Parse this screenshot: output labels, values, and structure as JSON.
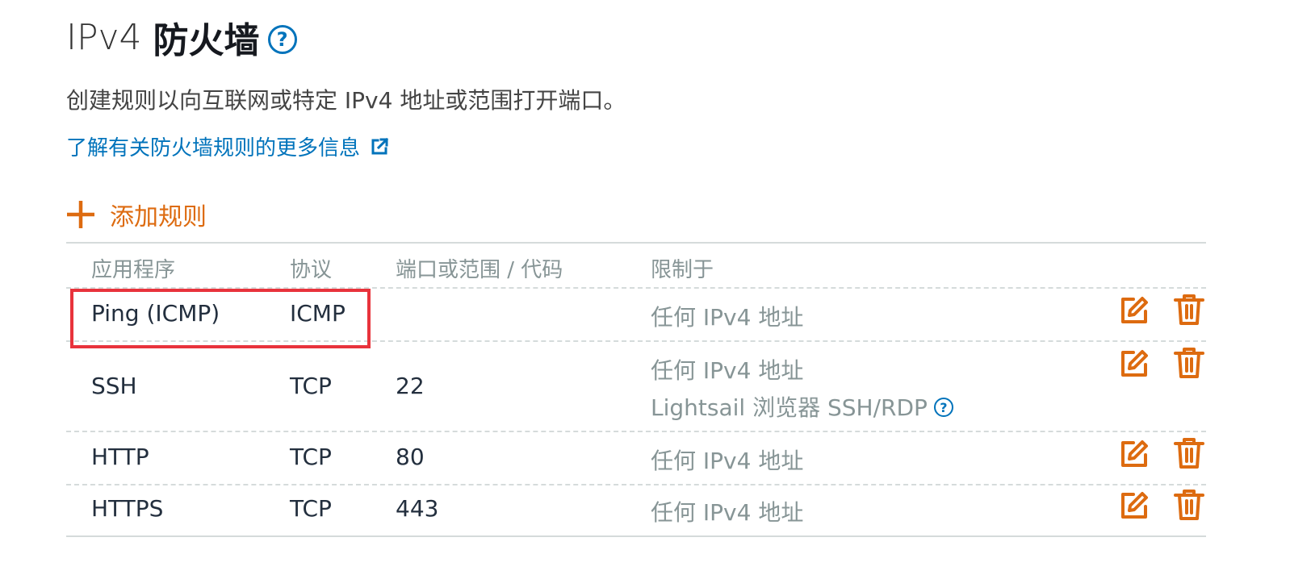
{
  "header": {
    "title_prefix": "IPv4",
    "title_main": "防火墙",
    "help_glyph": "?"
  },
  "description": "创建规则以向互联网或特定 IPv4 地址或范围打开端口。",
  "learn_more": {
    "label": "了解有关防火墙规则的更多信息",
    "icon": "external-link-icon"
  },
  "add_rule": {
    "label": "添加规则",
    "icon": "plus-icon"
  },
  "table": {
    "columns": [
      "应用程序",
      "协议",
      "端口或范围 / 代码",
      "限制于"
    ],
    "rows": [
      {
        "application": "Ping (ICMP)",
        "protocol": "ICMP",
        "port": "",
        "restrict": "任何 IPv4 地址",
        "restrict_extra": ""
      },
      {
        "application": "SSH",
        "protocol": "TCP",
        "port": "22",
        "restrict": "任何 IPv4 地址",
        "restrict_extra": "Lightsail 浏览器 SSH/RDP"
      },
      {
        "application": "HTTP",
        "protocol": "TCP",
        "port": "80",
        "restrict": "任何 IPv4 地址",
        "restrict_extra": ""
      },
      {
        "application": "HTTPS",
        "protocol": "TCP",
        "port": "443",
        "restrict": "任何 IPv4 地址",
        "restrict_extra": ""
      }
    ],
    "row_actions": [
      "edit-icon",
      "delete-icon"
    ]
  },
  "colors": {
    "accent_orange": "#dd6b10",
    "link_blue": "#0073bb",
    "highlight_red": "#e8333c",
    "muted_gray": "#879596"
  }
}
